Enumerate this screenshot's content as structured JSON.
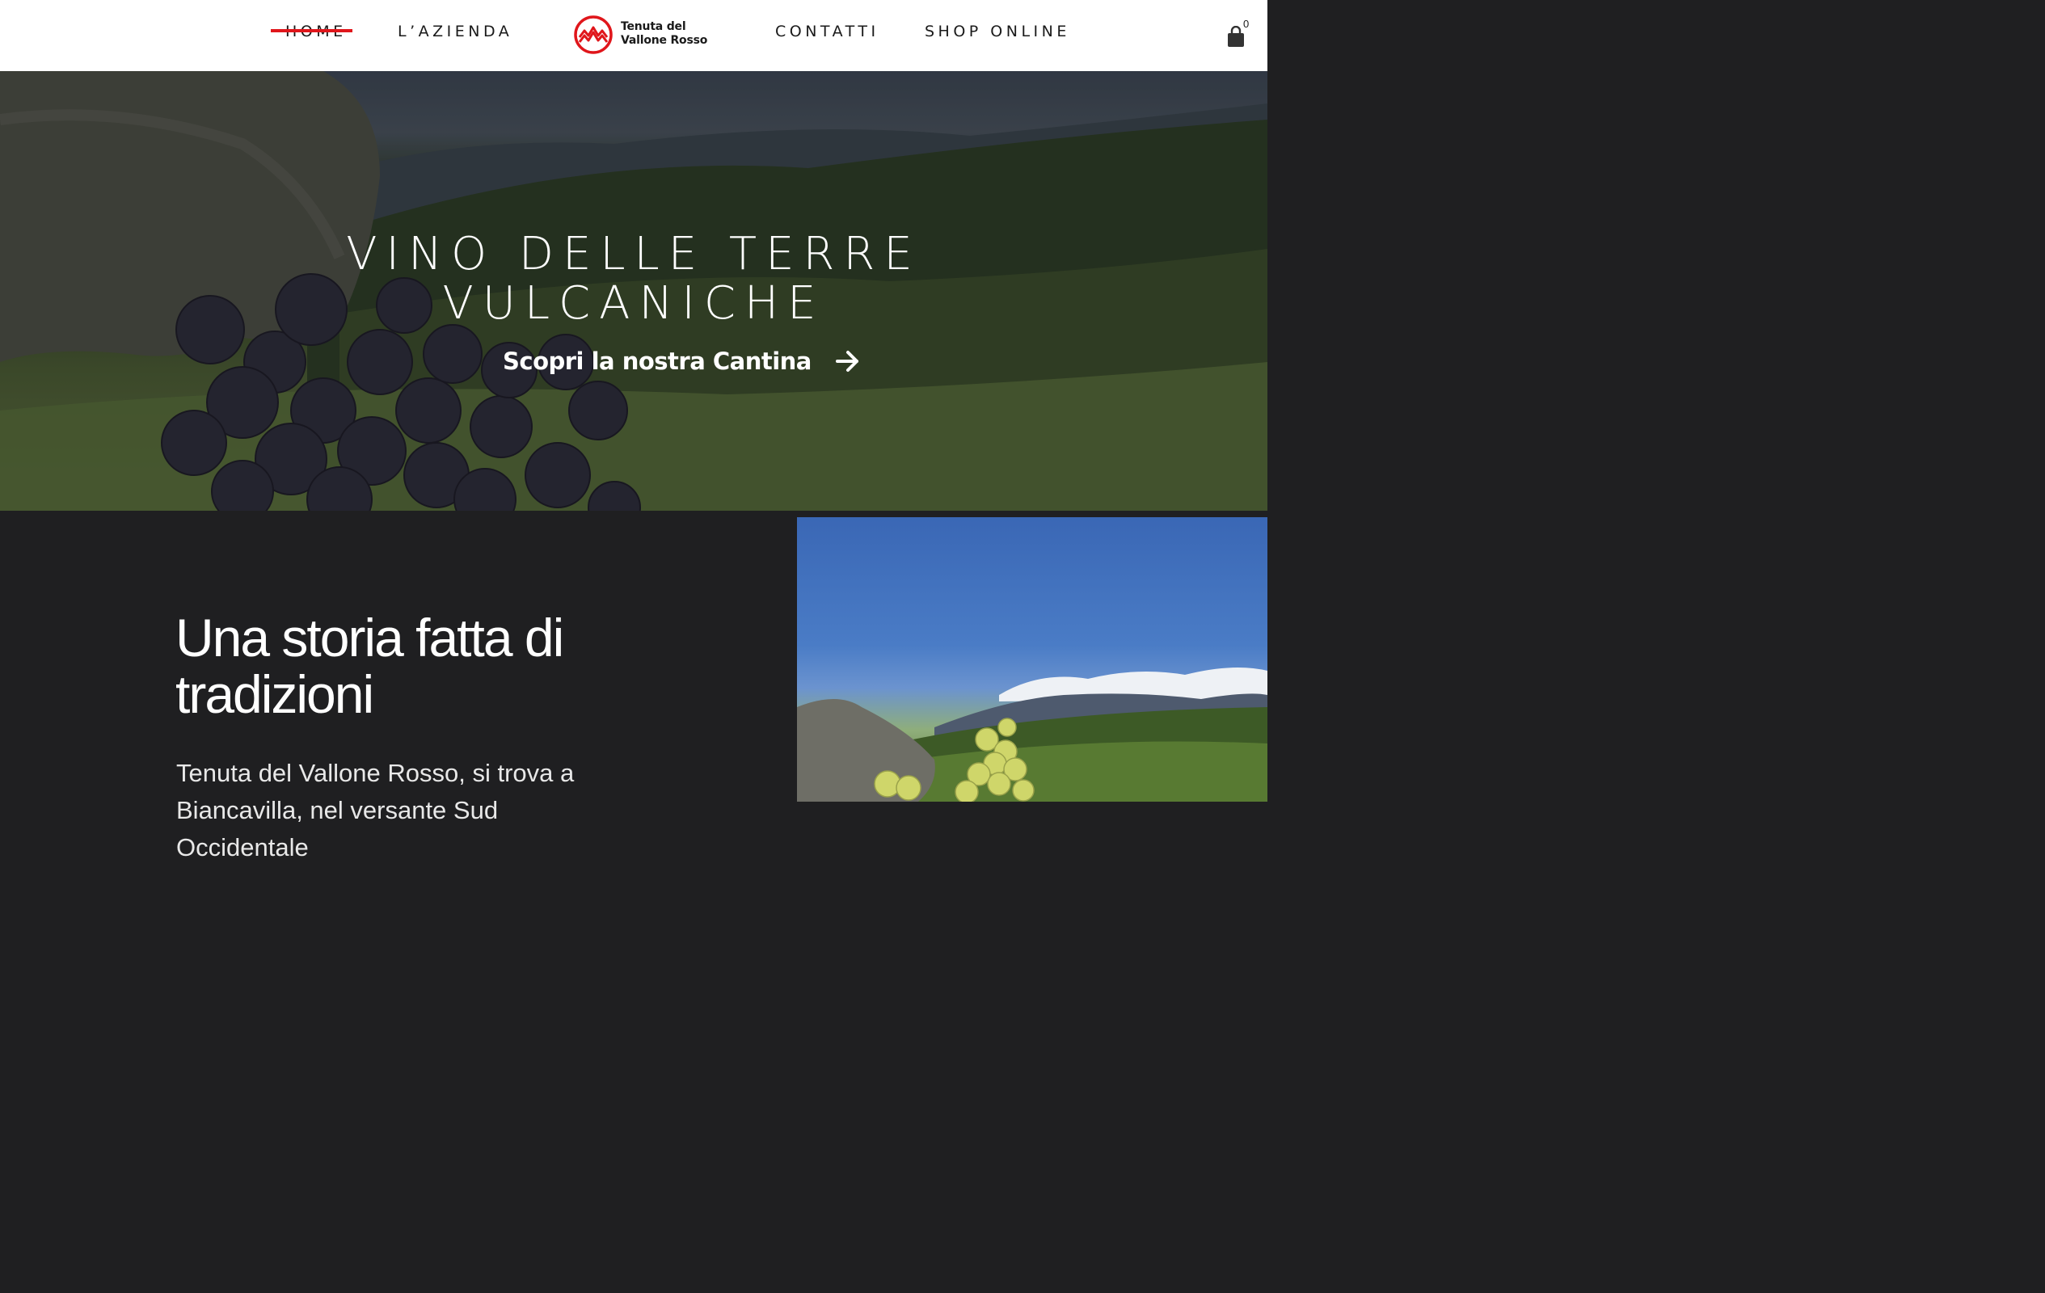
{
  "nav": {
    "home": "HOME",
    "azienda": "L’AZIENDA",
    "contatti": "CONTATTI",
    "shop": "SHOP ONLINE"
  },
  "logo": {
    "line1": "Tenuta del",
    "line2": "Vallone Rosso",
    "icon": "mountain-circle-icon"
  },
  "cart": {
    "count": "0",
    "icon": "shopping-bag-icon"
  },
  "hero": {
    "title_line1": "VINO DELLE TERRE",
    "title_line2": "VULCANICHE",
    "cta_label": "Scopri la nostra Cantina",
    "cta_icon": "arrow-right-icon"
  },
  "story": {
    "title": "Una storia fatta di tradizioni",
    "body": "Tenuta del Vallone Rosso, si trova a Biancavilla, nel versante Sud Occidentale"
  },
  "colors": {
    "accent": "#e0161b",
    "dark_bg": "#1f1f21",
    "header_bg": "#ffffff"
  }
}
